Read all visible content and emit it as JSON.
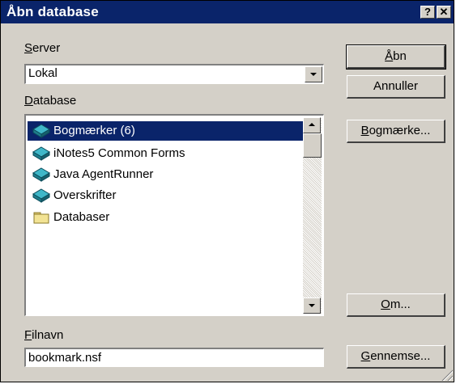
{
  "window": {
    "title": "Åbn database",
    "help_glyph": "?",
    "close_glyph": "✕"
  },
  "server": {
    "label_accel": "S",
    "label_rest": "erver",
    "value": "Lokal"
  },
  "database": {
    "label_accel": "D",
    "label_rest": "atabase",
    "items": [
      {
        "label": "Bogmærker (6)",
        "icon": "database-icon",
        "selected": true
      },
      {
        "label": "iNotes5 Common Forms",
        "icon": "database-icon",
        "selected": false
      },
      {
        "label": "Java AgentRunner",
        "icon": "database-icon",
        "selected": false
      },
      {
        "label": "Overskrifter",
        "icon": "database-icon",
        "selected": false
      },
      {
        "label": "Databaser",
        "icon": "folder-icon",
        "selected": false
      }
    ]
  },
  "filename": {
    "label_accel": "F",
    "label_rest": "ilnavn",
    "value": "bookmark.nsf"
  },
  "buttons": {
    "open_accel": "Å",
    "open_rest": "bn",
    "cancel": "Annuller",
    "bookmark_accel": "B",
    "bookmark_rest": "ogmærke...",
    "about_accel": "O",
    "about_rest": "m...",
    "browse_accel": "G",
    "browse_rest": "ennemse..."
  },
  "colors": {
    "titlebar": "#0a246a",
    "dialog_face": "#d4d0c8",
    "selection": "#0a246a"
  }
}
